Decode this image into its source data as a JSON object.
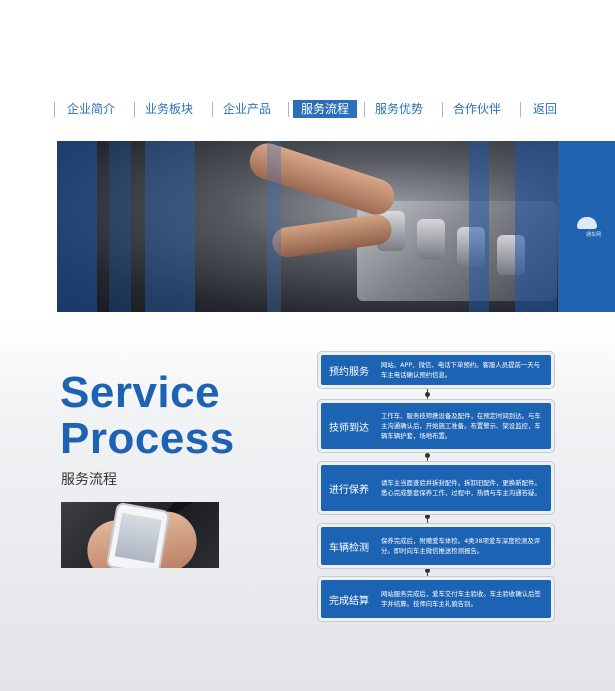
{
  "nav": {
    "items": [
      {
        "label": "企业简介"
      },
      {
        "label": "业务板块"
      },
      {
        "label": "企业产品"
      },
      {
        "label": "服务流程",
        "active": true
      },
      {
        "label": "服务优势"
      },
      {
        "label": "合作伙伴"
      },
      {
        "label": "返回"
      }
    ]
  },
  "hero": {
    "logo_text": "通车网"
  },
  "title": {
    "line1": "Service",
    "line2": "Process",
    "subtitle": "服务流程"
  },
  "steps": [
    {
      "label": "预约服务",
      "text": "网站、APP、微信、电话下单预约。客服人员提前一天与车主电话确认预约信息。"
    },
    {
      "label": "技师到达",
      "text": "工作车、服务技师携设备及配件，在预定时间到达。与车主沟通确认后，开始施工准备。布置警示、架设监控，车辆车辆护套，场地布置。"
    },
    {
      "label": "进行保养",
      "text": "请车主当面查验并拆封配件，拆卸旧配件，更换新配件。悉心完成整套保养工作，过程中，热情与车主沟通答疑。"
    },
    {
      "label": "车辆检测",
      "text": "保养完成后，附赠爱车体检。4类38项爱车深度检测及评分。即时向车主微信推送检测报告。"
    },
    {
      "label": "完成结算",
      "text": "网站服务完成后，爱车交付车主验收。车主验收确认后签字并结算。技师向车主礼貌告别。"
    }
  ],
  "colors": {
    "brand_blue": "#1d63b3",
    "nav_blue": "#2a6fb8"
  }
}
